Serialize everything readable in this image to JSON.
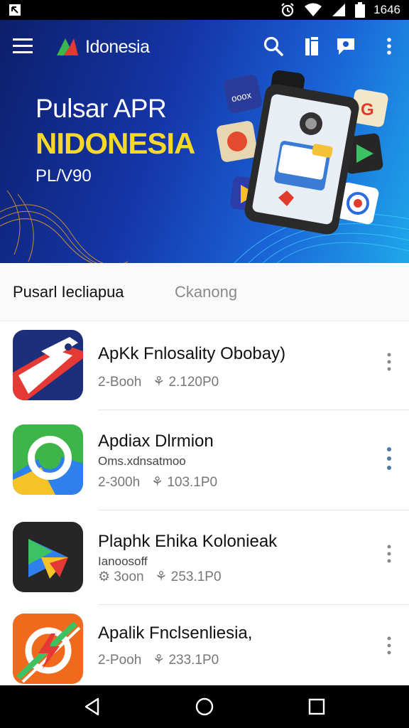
{
  "status": {
    "time": "1646",
    "icons": [
      "alarm-icon",
      "wifi-icon",
      "signal-icon",
      "battery-icon"
    ]
  },
  "toolbar": {
    "brand": "Idonesia",
    "icons": [
      "menu-icon",
      "search-icon",
      "bookmark-icon",
      "chat-icon",
      "more-vert-icon"
    ]
  },
  "hero": {
    "title_line1": "Pulsar APR",
    "title_line2": "NIDONESIA",
    "subtitle": "PL/V90",
    "accent_color": "#f6d82a"
  },
  "tabs": [
    {
      "label": "Pusarl Iecliapua",
      "active": true
    },
    {
      "label": "Ckanong",
      "active": false
    }
  ],
  "apps": [
    {
      "name": "ApKk Fnlosality Obobay)",
      "sub": "",
      "meta_left": "2-Booh",
      "meta_right": "2.120P0",
      "icon": "plane-app-icon",
      "color": "#1d2f7a"
    },
    {
      "name": "Apdiax Dlrmion",
      "sub": "Oms.xdnsatmoo",
      "meta_left": "2-300h",
      "meta_right": "103.1P0",
      "icon": "ring-app-icon",
      "color": "#3db54a"
    },
    {
      "name": "Plaphk Ehika Kolonieak",
      "sub": "Ianoosoff",
      "meta_left": "3oon",
      "meta_right": "253.1P0",
      "icon": "play-app-icon",
      "color": "#262626"
    },
    {
      "name": "Apalik Fnclsenliesia,",
      "sub": "",
      "meta_left": "2-Pooh",
      "meta_right": "233.1P0",
      "icon": "bolt-app-icon",
      "color": "#f06a1e"
    }
  ],
  "nav": [
    "back-icon",
    "home-icon",
    "recents-icon"
  ]
}
